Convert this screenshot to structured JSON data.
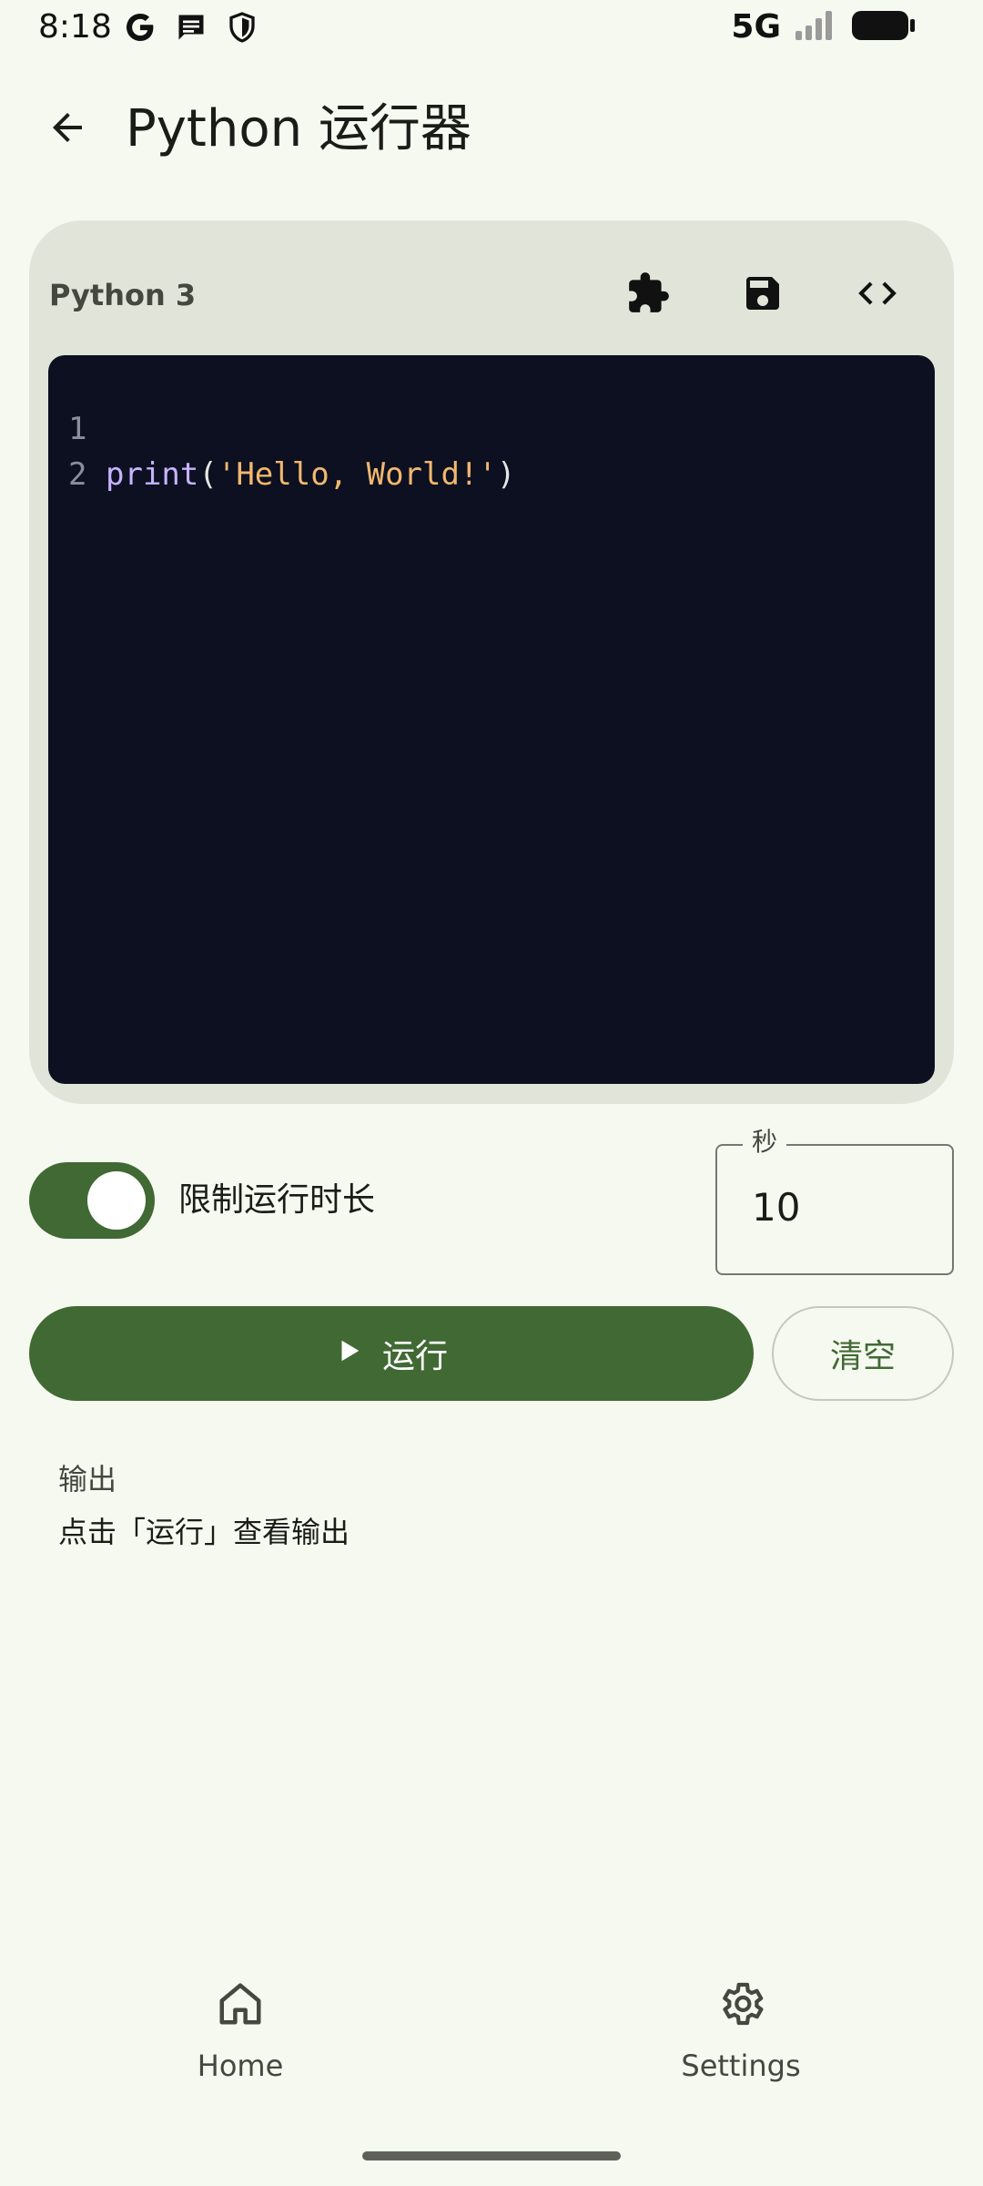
{
  "status_bar": {
    "time": "8:18",
    "network": "5G",
    "left_icons": [
      "google-icon",
      "message-icon",
      "shield-icon"
    ],
    "right_icons": [
      "signal-icon",
      "battery-icon"
    ]
  },
  "app_bar": {
    "title": "Python 运行器",
    "back_icon": "arrow-back-icon"
  },
  "editor": {
    "language": "Python 3",
    "tools": [
      "puzzle-icon",
      "save-icon",
      "code-icon"
    ],
    "lines": [
      {
        "no": "1",
        "tokens": [
          {
            "text": "print",
            "kind": "fn"
          },
          {
            "text": "(",
            "kind": "punc"
          },
          {
            "text": "'Hello, World!'",
            "kind": "str"
          },
          {
            "text": ")",
            "kind": "punc"
          }
        ]
      },
      {
        "no": "2",
        "tokens": []
      }
    ]
  },
  "time_limit": {
    "enabled": true,
    "label": "限制运行时长",
    "seconds_label": "秒",
    "seconds_value": "10"
  },
  "actions": {
    "run_label": "运行",
    "clear_label": "清空"
  },
  "output": {
    "title": "输出",
    "placeholder": "点击「运行」查看输出"
  },
  "bottom_nav": {
    "items": [
      {
        "label": "Home",
        "icon": "home-icon"
      },
      {
        "label": "Settings",
        "icon": "settings-icon"
      }
    ]
  },
  "colors": {
    "background": "#f6f9f0",
    "primary": "#416934",
    "card": "#e1e5d9",
    "editor_bg": "#0c1020"
  }
}
